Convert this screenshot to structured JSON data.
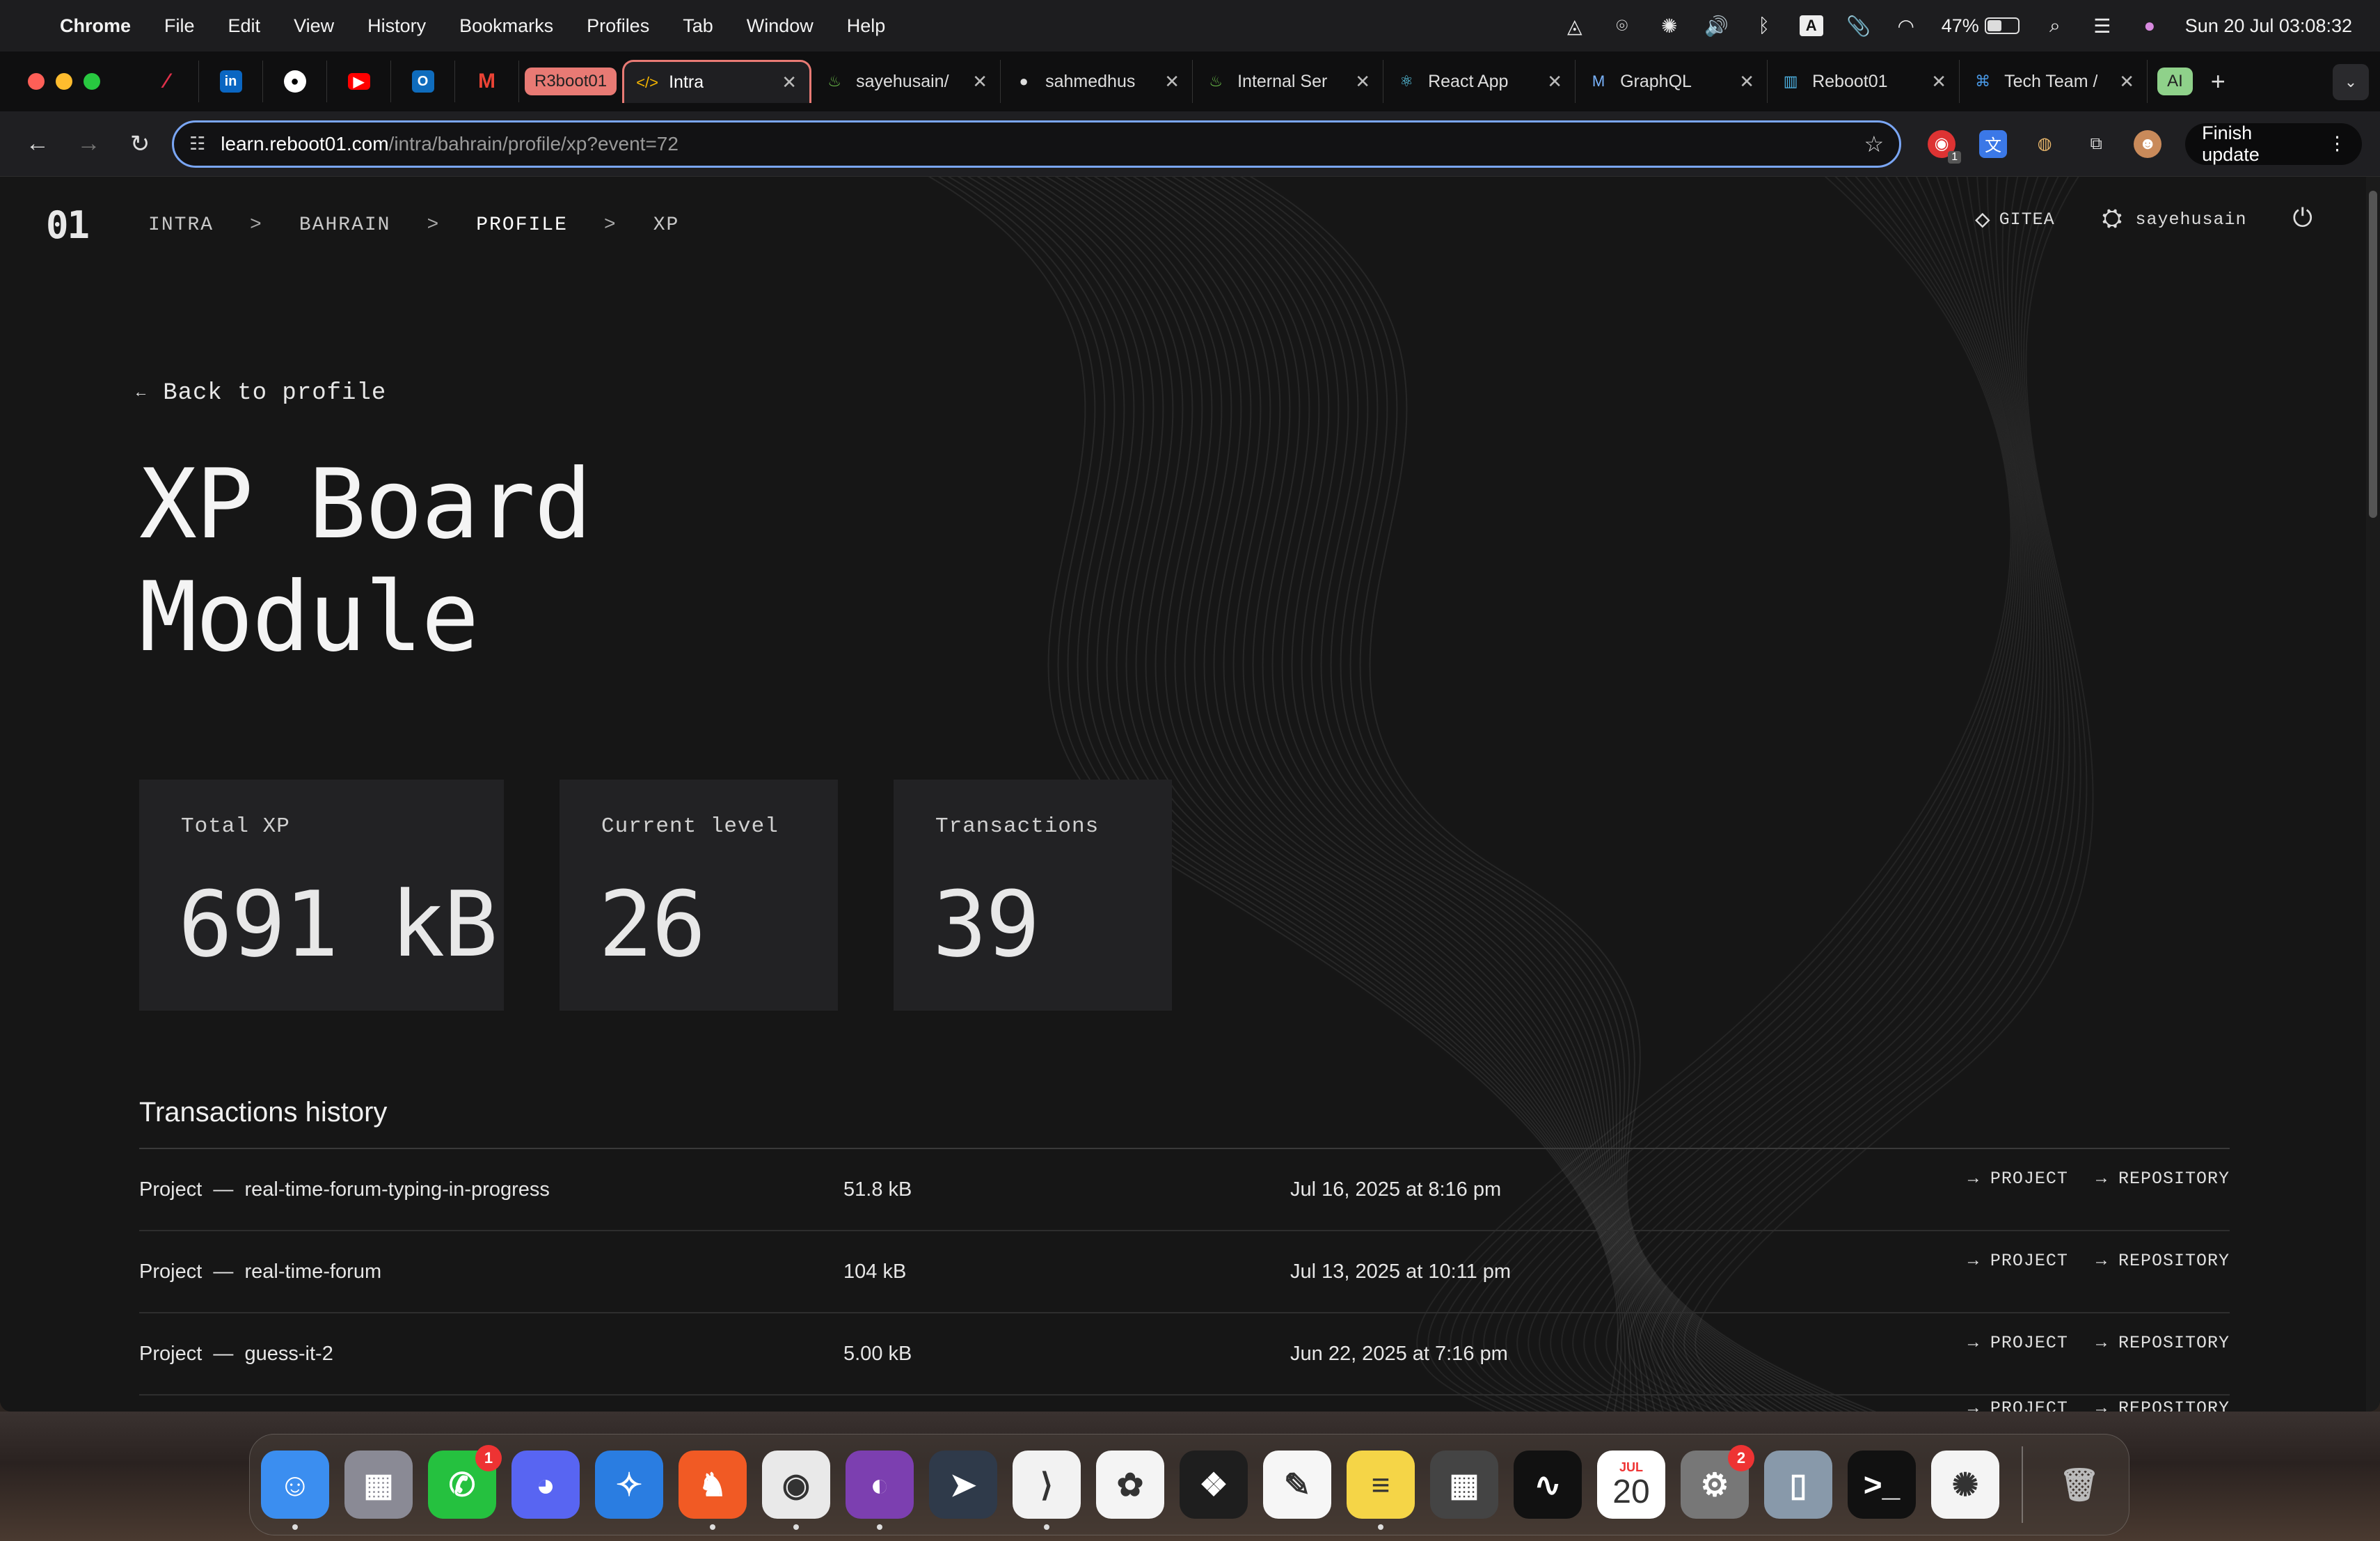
{
  "menubar": {
    "app_name": "Chrome",
    "items": [
      "File",
      "Edit",
      "View",
      "History",
      "Bookmarks",
      "Profiles",
      "Tab",
      "Window",
      "Help"
    ],
    "battery_percent": "47%",
    "battery_level": 0.47,
    "datetime": "Sun 20 Jul  03:08:32"
  },
  "tabs": {
    "group_label": "R3boot01",
    "items": [
      {
        "label": "Intra",
        "icon": "code-icon",
        "active": true
      },
      {
        "label": "sayehusain/",
        "icon": "gitea-icon"
      },
      {
        "label": "sahmedhus",
        "icon": "github-icon"
      },
      {
        "label": "Internal Ser",
        "icon": "gitea-icon"
      },
      {
        "label": "React App",
        "icon": "react-icon"
      },
      {
        "label": "GraphQL",
        "icon": "m-icon"
      },
      {
        "label": "Reboot01",
        "icon": "chart-icon"
      },
      {
        "label": "Tech Team /",
        "icon": "translate-icon"
      }
    ],
    "ai_label": "AI",
    "new_tab": "+"
  },
  "toolbar": {
    "url_host": "learn.reboot01.com",
    "url_path": "/intra/bahrain/profile/xp?event=72",
    "finish_update": "Finish update",
    "ext_badge": "1"
  },
  "site": {
    "logo": "01",
    "breadcrumbs": [
      "INTRA",
      "BAHRAIN",
      "PROFILE",
      "XP"
    ],
    "separator": ">",
    "gitea_label": "GITEA",
    "username": "sayehusain"
  },
  "main": {
    "back_label": "Back to profile",
    "title_line1": "XP Board",
    "title_line2": "Module",
    "stats": [
      {
        "label": "Total XP",
        "value": "691 kB"
      },
      {
        "label": "Current level",
        "value": "26"
      },
      {
        "label": "Transactions",
        "value": "39"
      }
    ],
    "history_title": "Transactions history",
    "history": [
      {
        "type": "Project",
        "name": "real-time-forum-typing-in-progress",
        "amount": "51.8 kB",
        "date": "Jul 16, 2025 at 8:16 pm"
      },
      {
        "type": "Project",
        "name": "real-time-forum",
        "amount": "104 kB",
        "date": "Jul 13, 2025 at 10:11 pm"
      },
      {
        "type": "Project",
        "name": "guess-it-2",
        "amount": "5.00 kB",
        "date": "Jun 22, 2025 at 7:16 pm"
      }
    ],
    "link_project": "PROJECT",
    "link_repository": "REPOSITORY",
    "dash": "—"
  },
  "dock": {
    "apps": [
      {
        "name": "finder",
        "color": "#3b8ef0",
        "glyph": "☺",
        "dot": true
      },
      {
        "name": "launchpad",
        "color": "#8a8a95",
        "glyph": "▦"
      },
      {
        "name": "whatsapp",
        "color": "#25c13f",
        "glyph": "✆",
        "badge": "1"
      },
      {
        "name": "discord",
        "color": "#5865f2",
        "glyph": "◕"
      },
      {
        "name": "safari",
        "color": "#2a7de1",
        "glyph": "✧"
      },
      {
        "name": "brave",
        "color": "#f15a24",
        "glyph": "♞",
        "dot": true
      },
      {
        "name": "chrome",
        "color": "#e9e9e9",
        "glyph": "◉",
        "dot": true
      },
      {
        "name": "github-desktop",
        "color": "#7c3fb0",
        "glyph": "◐",
        "dot": true
      },
      {
        "name": "prompt",
        "color": "#2f3a4a",
        "glyph": "➤"
      },
      {
        "name": "vscode",
        "color": "#f2f2f2",
        "glyph": "⟩",
        "dot": true
      },
      {
        "name": "photos",
        "color": "#f4f4f4",
        "glyph": "✿"
      },
      {
        "name": "figma",
        "color": "#1e1e1e",
        "glyph": "❖"
      },
      {
        "name": "freeform",
        "color": "#f6f6f6",
        "glyph": "✎"
      },
      {
        "name": "notes",
        "color": "#f5d547",
        "glyph": "≡",
        "dot": true
      },
      {
        "name": "calculator",
        "color": "#444",
        "glyph": "▦"
      },
      {
        "name": "activity-monitor",
        "color": "#111",
        "glyph": "∿"
      },
      {
        "name": "calendar",
        "color": "#fff",
        "glyph": "20",
        "month": "JUL"
      },
      {
        "name": "system-settings",
        "color": "#777",
        "glyph": "⚙",
        "badge": "2"
      },
      {
        "name": "iphone-mirroring",
        "color": "#8899aa",
        "glyph": "▯"
      },
      {
        "name": "terminal",
        "color": "#111",
        "glyph": ">_"
      },
      {
        "name": "chatgpt",
        "color": "#f4f4f4",
        "glyph": "✺"
      }
    ],
    "trash": {
      "name": "trash",
      "color": "#9a9a9a",
      "glyph": "🗑"
    }
  }
}
